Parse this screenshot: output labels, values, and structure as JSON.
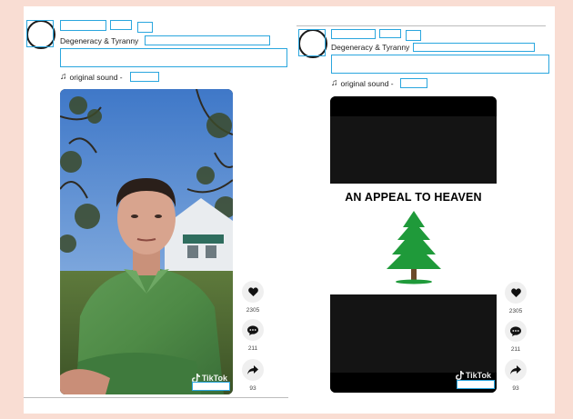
{
  "posts": [
    {
      "author": "Degeneracy & Tyranny",
      "sound_label": "original sound -",
      "actions": {
        "likes": "2305",
        "comments": "211",
        "shares": "93"
      },
      "watermark": "TikTok"
    },
    {
      "author": "Degeneracy & Tyranny",
      "sound_label": "original sound -",
      "video_title": "AN APPEAL TO HEAVEN",
      "actions": {
        "likes": "2305",
        "comments": "211",
        "shares": "93"
      },
      "watermark": "TikTok"
    }
  ],
  "colors": {
    "page_background": "#f9ddd3",
    "redaction_box": "#2aa6de"
  },
  "icons": [
    "music-note-icon",
    "heart-icon",
    "comment-icon",
    "share-icon",
    "tiktok-logo-icon",
    "pine-tree-icon"
  ]
}
